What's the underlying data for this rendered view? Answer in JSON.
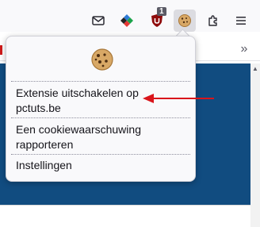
{
  "toolbar": {
    "icons": [
      {
        "name": "mail-icon",
        "label": "Mail"
      },
      {
        "name": "colorful-extension-icon",
        "label": "Extension"
      },
      {
        "name": "ublock-origin-icon",
        "label": "uBlock Origin",
        "badge": "1"
      },
      {
        "name": "cookie-autodelete-icon",
        "label": "Cookie extension",
        "active": true
      },
      {
        "name": "extensions-puzzle-icon",
        "label": "Extensions"
      },
      {
        "name": "hamburger-menu-icon",
        "label": "Menu"
      }
    ],
    "overflow_glyph": "»"
  },
  "popup": {
    "logo_icon": "cookie-icon",
    "items": [
      {
        "line1": "Extensie uitschakelen op",
        "line2": "pctuts.be"
      },
      {
        "line1": "Een cookiewaarschuwing",
        "line2": "rapporteren"
      },
      {
        "line1": "Instellingen",
        "line2": ""
      }
    ]
  },
  "annotation": {
    "type": "arrow",
    "color": "#d9151b",
    "points_to": "popup.items.0"
  },
  "colors": {
    "page_blue": "#114c80",
    "popup_bg": "#f9f9fb",
    "toolbar_bg": "#f9f9fb",
    "arrow_red": "#d9151b"
  }
}
